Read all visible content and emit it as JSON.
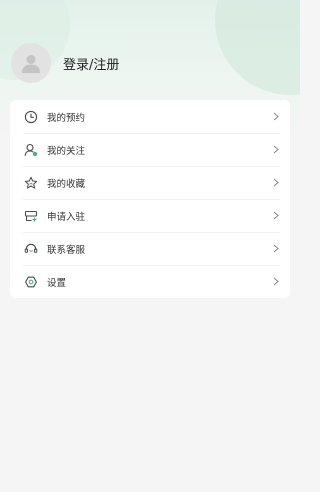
{
  "profile": {
    "login_label": "登录/注册"
  },
  "menu": {
    "items": [
      {
        "label": "我的预约",
        "icon": "clock-icon"
      },
      {
        "label": "我的关注",
        "icon": "user-follow-icon"
      },
      {
        "label": "我的收藏",
        "icon": "star-icon"
      },
      {
        "label": "申请入驻",
        "icon": "shop-apply-icon"
      },
      {
        "label": "联系客服",
        "icon": "headset-icon"
      },
      {
        "label": "设置",
        "icon": "settings-icon"
      }
    ]
  },
  "colors": {
    "accent": "#4caf82",
    "header_tint": "#e3f1ea",
    "background": "#f5f5f5"
  }
}
